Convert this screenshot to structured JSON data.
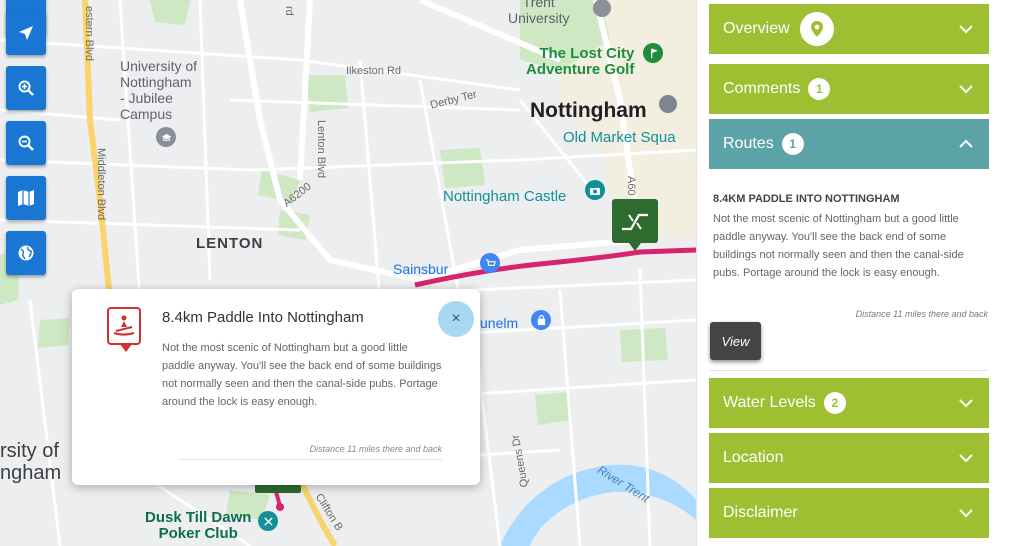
{
  "map": {
    "labels": {
      "trent_university": "Trent\nUniversity",
      "university_of_nottingham": "University of\nNottingham\n- Jubilee\nCampus",
      "lost_city": "The Lost City\nAdventure Golf",
      "nottingham": "Nottingham",
      "old_market": "Old Market Squa",
      "nottingham_castle": "Nottingham Castle",
      "lenton": "LENTON",
      "sainsburys": "Sainsbur",
      "dunelm": "unelm",
      "dusk_till_dawn": "Dusk Till Dawn\nPoker Club",
      "university_of_left": "rsity of\nngham",
      "river_trent": "River Trent",
      "ilkeston_rd": "Ilkeston Rd",
      "derby_ter": "Derby Ter",
      "lenton_blvd": "Lenton Blvd",
      "a6200": "A6200",
      "middleton_blvd": "Middleton Blvd",
      "western_blvd": "estern Blvd",
      "clifton_b": "Clifton B",
      "queens_dr": "Queens Dr",
      "a60": "A60",
      "rd": "rd"
    },
    "toolbar": [
      {
        "icon": "locate-arrow-icon"
      },
      {
        "icon": "zoom-in-icon"
      },
      {
        "icon": "zoom-out-icon"
      },
      {
        "icon": "map-layers-icon"
      },
      {
        "icon": "globe-icon"
      }
    ]
  },
  "popup": {
    "title": "8.4km Paddle Into Nottingham",
    "description": "Not the most scenic of Nottingham but a good little paddle anyway. You'll see the back end of some buildings not normally seen and then the canal-side pubs. Portage around the lock is easy enough.",
    "distance": "Distance 11 miles there and back",
    "close_label": "×"
  },
  "sidebar": {
    "overview": {
      "label": "Overview"
    },
    "comments": {
      "label": "Comments",
      "count": "1"
    },
    "routes": {
      "label": "Routes",
      "count": "1"
    },
    "route": {
      "title": "8.4KM PADDLE INTO NOTTINGHAM",
      "description": "Not the most scenic of Nottingham but a good little paddle anyway. You'll see the back end of some buildings not normally seen and then the canal-side pubs. Portage around the lock is easy enough.",
      "distance": "Distance 11 miles there and back",
      "view_label": "View"
    },
    "water_levels": {
      "label": "Water Levels",
      "count": "2"
    },
    "location": {
      "label": "Location"
    },
    "disclaimer": {
      "label": "Disclaimer"
    }
  },
  "colors": {
    "accordion_green": "#9ebf32",
    "accordion_teal": "#5ba3a6",
    "toolbar_blue": "#1976d2",
    "route_line": "#d6246e"
  }
}
